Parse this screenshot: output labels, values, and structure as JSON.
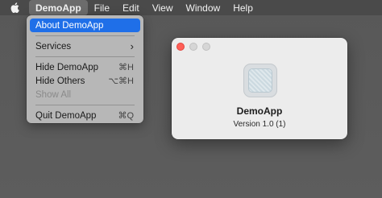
{
  "menubar": {
    "app_name": "DemoApp",
    "items": [
      "File",
      "Edit",
      "View",
      "Window",
      "Help"
    ]
  },
  "app_menu": {
    "items": [
      {
        "label": "About DemoApp",
        "shortcut": "",
        "selected": true
      },
      {
        "label": "Services",
        "submenu": true
      },
      {
        "label": "Hide DemoApp",
        "shortcut": "⌘H"
      },
      {
        "label": "Hide Others",
        "shortcut": "⌥⌘H"
      },
      {
        "label": "Show All",
        "disabled": true
      },
      {
        "label": "Quit DemoApp",
        "shortcut": "⌘Q"
      }
    ]
  },
  "about_window": {
    "app_name": "DemoApp",
    "version": "Version 1.0 (1)"
  },
  "colors": {
    "selection": "#1f6fe8",
    "close_button": "#ff5f57"
  },
  "icons": {
    "apple": "apple-logo-icon",
    "submenu": "chevron-right-icon",
    "app": "app-icon"
  }
}
